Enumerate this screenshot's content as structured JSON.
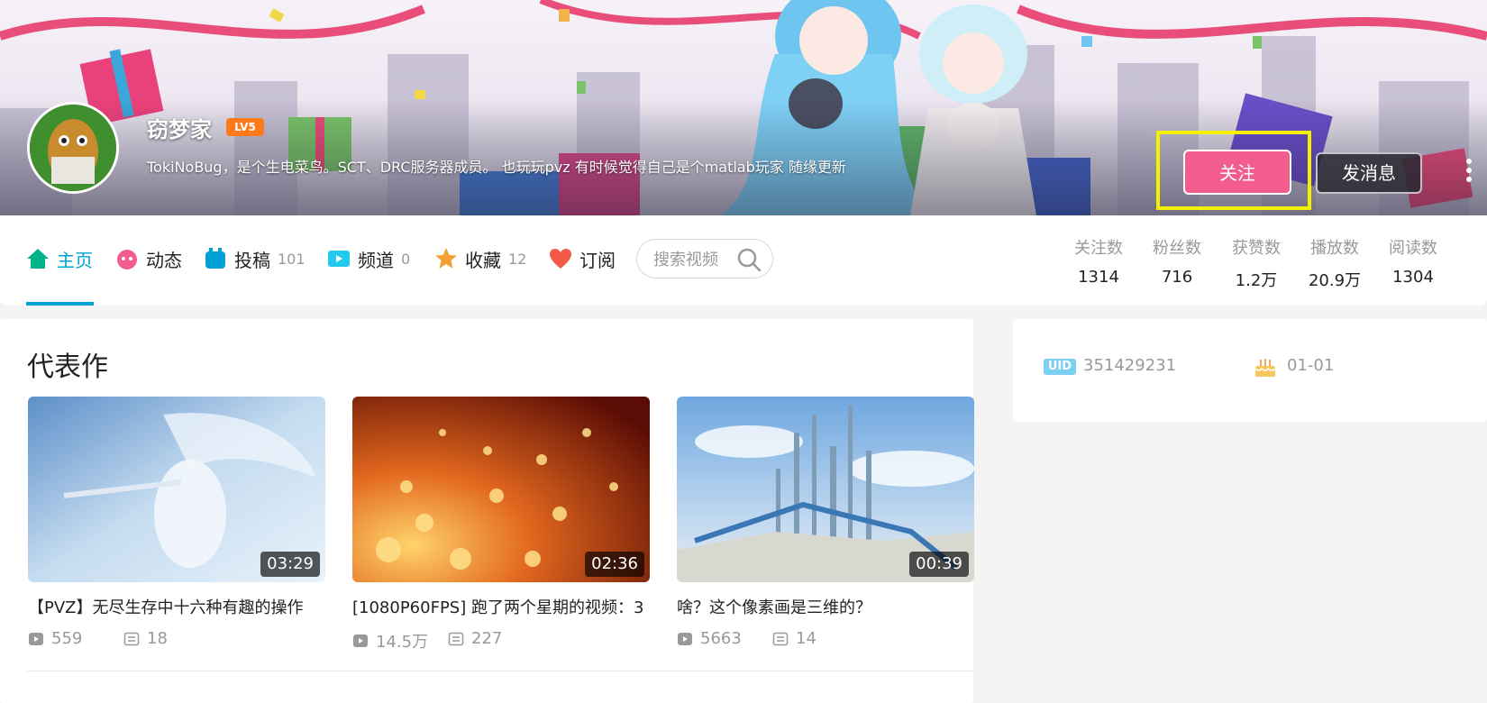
{
  "profile": {
    "username": "窃梦家",
    "level": "LV5",
    "signature": "TokiNoBug，是个生电菜鸟。SCT、DRC服务器成员。 也玩玩pvz 有时候觉得自己是个matlab玩家 随缘更新",
    "follow_label": "关注",
    "message_label": "发消息"
  },
  "nav": {
    "items": [
      {
        "label": "主页",
        "count": "",
        "icon": "home-icon",
        "active": true
      },
      {
        "label": "动态",
        "count": "",
        "icon": "dynamic-icon"
      },
      {
        "label": "投稿",
        "count": "101",
        "icon": "upload-icon"
      },
      {
        "label": "频道",
        "count": "0",
        "icon": "channel-icon"
      },
      {
        "label": "收藏",
        "count": "12",
        "icon": "star-icon"
      },
      {
        "label": "订阅",
        "count": "",
        "icon": "heart-icon"
      }
    ],
    "search_placeholder": "搜索视频"
  },
  "stats": [
    {
      "label": "关注数",
      "value": "1314"
    },
    {
      "label": "粉丝数",
      "value": "716"
    },
    {
      "label": "获赞数",
      "value": "1.2万"
    },
    {
      "label": "播放数",
      "value": "20.9万"
    },
    {
      "label": "阅读数",
      "value": "1304"
    }
  ],
  "main": {
    "section_title": "代表作",
    "videos": [
      {
        "title": "【PVZ】无尽生存中十六种有趣的操作",
        "duration": "03:29",
        "plays": "559",
        "danmaku": "18"
      },
      {
        "title": "[1080P60FPS] 跑了两个星期的视频：3",
        "duration": "02:36",
        "plays": "14.5万",
        "danmaku": "227"
      },
      {
        "title": "啥？这个像素画是三维的？",
        "duration": "00:39",
        "plays": "5663",
        "danmaku": "14"
      }
    ]
  },
  "side": {
    "uid_label": "UID",
    "uid": "351429231",
    "birthday": "01-01"
  },
  "colors": {
    "accent": "#00a1d6",
    "follow": "#f25d8e",
    "level": "#ff7a18",
    "highlight": "#f5f000"
  }
}
